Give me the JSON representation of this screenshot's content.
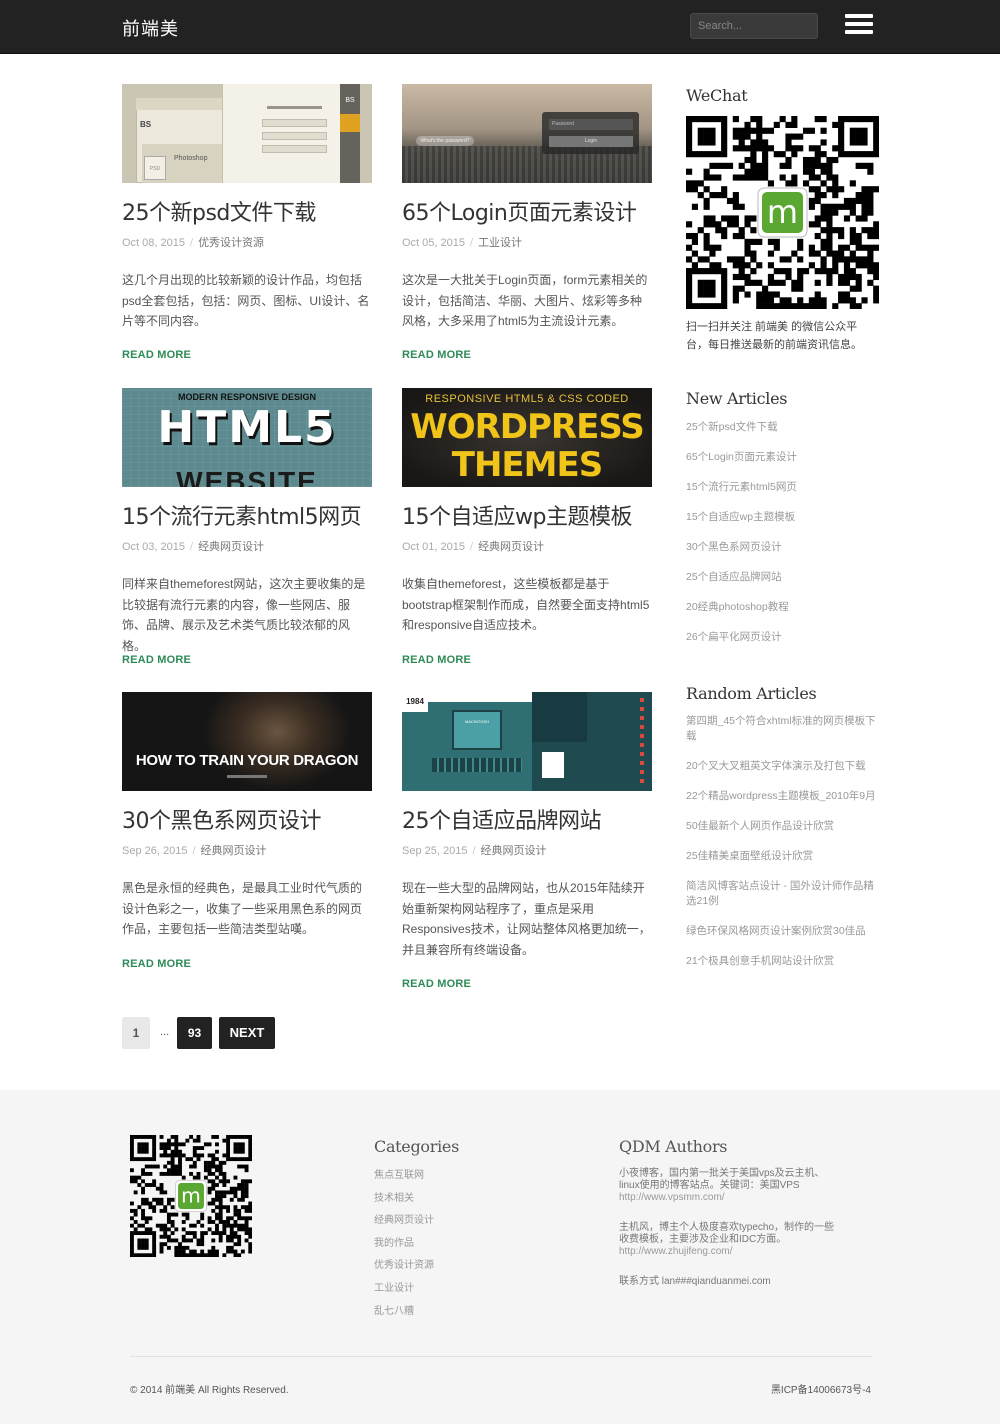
{
  "header": {
    "brand": "前端美",
    "search_placeholder": "Search..."
  },
  "posts": [
    {
      "title": "25个新psd文件下载",
      "date": "Oct 08, 2015",
      "category": "优秀设计资源",
      "excerpt": "这几个月出现的比较新颖的设计作品，均包括psd全套包括，包括：网页、图标、UI设计、名片等不同内容。",
      "read_more": "READ MORE",
      "thumb_text": [
        "BS",
        "Photoshop",
        "PSD",
        "BS"
      ]
    },
    {
      "title": "65个Login页面元素设计",
      "date": "Oct 05, 2015",
      "category": "工业设计",
      "excerpt": "这次是一大批关于Login页面，form元素相关的设计，包括简洁、华丽、大图片、炫彩等多种风格，大多采用了html5为主流设计元素。",
      "read_more": "READ MORE",
      "thumb_text": [
        "What's the password?",
        "Password",
        "Login"
      ]
    },
    {
      "title": "15个流行元素html5网页",
      "date": "Oct 03, 2015",
      "category": "经典网页设计",
      "excerpt": "同样来自themeforest网站，这次主要收集的是比较据有流行元素的内容，像一些网店、服饰、品牌、展示及艺术类气质比较浓郁的风格。",
      "read_more": "READ MORE",
      "thumb_text": [
        "MODERN RESPONSIVE DESIGN",
        "HTML5",
        "WEBSITE"
      ]
    },
    {
      "title": "15个自适应wp主题模板",
      "date": "Oct 01, 2015",
      "category": "经典网页设计",
      "excerpt": "收集自themeforest，这些模板都是基于bootstrap框架制作而成，自然要全面支持html5和responsive自适应技术。",
      "read_more": "READ MORE",
      "thumb_text": [
        "RESPONSIVE HTML5 & CSS CODED",
        "WORDPRESS",
        "THEMES"
      ]
    },
    {
      "title": "30个黑色系网页设计",
      "date": "Sep 26, 2015",
      "category": "经典网页设计",
      "excerpt": "黑色是永恒的经典色，是最具工业时代气质的设计色彩之一，收集了一些采用黑色系的网页作品，主要包括一些简洁类型站嘆。",
      "read_more": "READ MORE",
      "thumb_text": [
        "HOW TO TRAIN YOUR DRAGON"
      ]
    },
    {
      "title": "25个自适应品牌网站",
      "date": "Sep 25, 2015",
      "category": "经典网页设计",
      "excerpt": "现在一些大型的品牌网站，也从2015年陆续开始重新架构网站程序了，重点是采用Responsives技术，让网站整体风格更加统一，并且兼容所有终端设备。",
      "read_more": "READ MORE",
      "thumb_text": [
        "1984",
        "MACINTOSH"
      ]
    }
  ],
  "pagination": {
    "current": "1",
    "dots": "...",
    "last": "93",
    "next": "NEXT"
  },
  "sidebar": {
    "wechat_heading": "WeChat",
    "wechat_text": "扫一扫并关注 前端美 的微信公众平台，每日推送最新的前端资讯信息。",
    "new_heading": "New Articles",
    "new_articles": [
      "25个新psd文件下载",
      "65个Login页面元素设计",
      "15个流行元素html5网页",
      "15个自适应wp主题模板",
      "30个黑色系网页设计",
      "25个自适应品牌网站",
      "20经典photoshop教程",
      "26个扁平化网页设计"
    ],
    "random_heading": "Random Articles",
    "random_articles": [
      "第四期_45个符合xhtml标准的网页模板下载",
      "20个叉大叉粗英文字体演示及打包下载",
      "22个精品wordpress主题模板_2010年9月",
      "50佳最新个人网页作品设计欣赏",
      "25佳精美桌面壁纸设计欣赏",
      "简洁风博客站点设计 - 国外设计师作品精选21例",
      "绿色环保风格网页设计案例欣赏30佳品",
      "21个极具创意手机网站设计欣赏"
    ]
  },
  "footer": {
    "categories_heading": "Categories",
    "categories": [
      "焦点互联网",
      "技术相关",
      "经典网页设计",
      "我的作品",
      "优秀设计资源",
      "工业设计",
      "乱七八糟"
    ],
    "authors_heading": "QDM Authors",
    "authors": [
      {
        "text": "小夜博客，国内第一批关于美国vps及云主机、linux使用的博客站点。关键词：美国VPS",
        "url": "http://www.vpsmm.com/"
      },
      {
        "text": "主机风，博主个人极度喜欢typecho，制作的一些收费模板，主要涉及企业和IDC方面。",
        "url": "http://www.zhujifeng.com/"
      }
    ],
    "contact": "联系方式 lan###qianduanmei.com",
    "copyright": "© 2014 前端美 All Rights Reserved.",
    "icp": "黑ICP备14006673号-4"
  },
  "qr_logo_letter": "m",
  "colors": {
    "topbar": "#222222",
    "read_more": "#2e8b57",
    "qr_logo": "#5aa832",
    "footer_bg": "#f5f5f5"
  }
}
